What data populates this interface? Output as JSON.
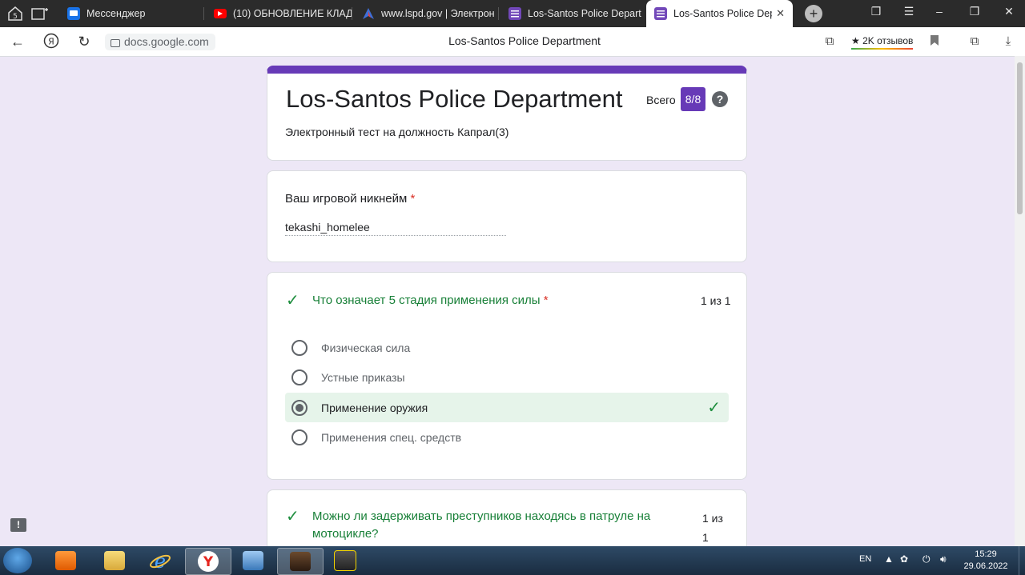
{
  "browser": {
    "tabs": [
      {
        "title": "Мессенджер",
        "icon": "messenger-icon",
        "active": false
      },
      {
        "title": "(10) ОБНОВЛЕНИЕ КЛАД",
        "icon": "youtube-icon",
        "active": false
      },
      {
        "title": "www.lspd.gov | Электрон",
        "icon": "lspd-icon",
        "active": false
      },
      {
        "title": "Los-Santos Police Depart",
        "icon": "google-forms-icon",
        "active": false
      },
      {
        "title": "Los-Santos Police Depa",
        "icon": "google-forms-icon",
        "active": true
      }
    ],
    "url": "docs.google.com",
    "page_title": "Los-Santos Police Department",
    "reviews_label": "2K отзывов"
  },
  "form": {
    "title": "Los-Santos Police Department",
    "total_label": "Всего",
    "score": "8/8",
    "description": "Электронный тест на должность Капрал(3)",
    "nickname": {
      "label": "Ваш игровой никнейм",
      "required_mark": "*",
      "value": "tekashi_homelee"
    },
    "questions": [
      {
        "title": "Что означает 5 стадия применения силы",
        "required_mark": "*",
        "points": "1 из 1",
        "options": [
          {
            "label": "Физическая сила",
            "selected": false,
            "correct": false
          },
          {
            "label": "Устные приказы",
            "selected": false,
            "correct": false
          },
          {
            "label": "Применение оружия",
            "selected": true,
            "correct": true
          },
          {
            "label": "Применения спец. средств",
            "selected": false,
            "correct": false
          }
        ]
      },
      {
        "title": "Можно ли задерживать преступников находясь в патруле на мотоцикле?",
        "points_line1": "1 из",
        "points_line2": "1"
      }
    ]
  },
  "taskbar": {
    "language": "EN",
    "time": "15:29",
    "date": "29.06.2022"
  },
  "colors": {
    "accent": "#673ab7",
    "page_bg": "#ede7f6",
    "correct_green": "#1e8e3e",
    "correct_bg": "#e6f4ea"
  }
}
